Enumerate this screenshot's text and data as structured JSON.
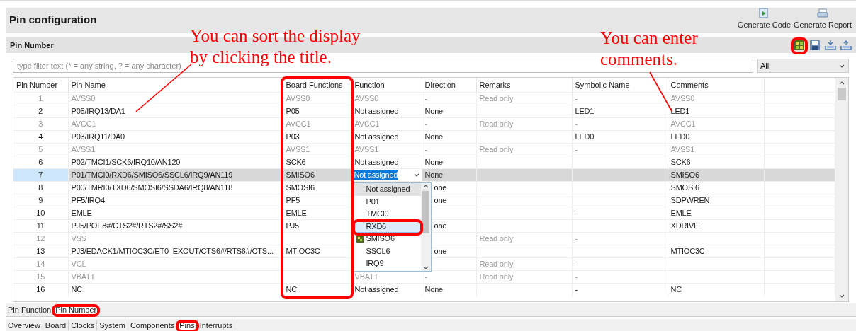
{
  "header": {
    "title": "Pin configuration",
    "actions": [
      {
        "label": "Generate Code",
        "kind": "code"
      },
      {
        "label": "Generate Report",
        "kind": "report"
      }
    ]
  },
  "section": {
    "title": "Pin Number",
    "tools": [
      {
        "kind": "grid",
        "highlighted": true
      },
      {
        "kind": "save",
        "highlighted": false
      },
      {
        "kind": "import",
        "highlighted": false
      },
      {
        "kind": "export",
        "highlighted": false
      }
    ]
  },
  "filter": {
    "placeholder": "type filter text (* = any string, ? = any character)",
    "scope": "All"
  },
  "table": {
    "columns": [
      {
        "label": "Pin Number",
        "highlighted": false
      },
      {
        "label": "Pin Name",
        "highlighted": false
      },
      {
        "label": "Board Functions",
        "highlighted": true
      },
      {
        "label": "Function",
        "highlighted": false
      },
      {
        "label": "Direction",
        "highlighted": false
      },
      {
        "label": "Remarks",
        "highlighted": false
      },
      {
        "label": "Symbolic Name",
        "highlighted": false
      },
      {
        "label": "Comments",
        "highlighted": false
      }
    ],
    "rows": [
      {
        "read_only": true,
        "selected": false,
        "cells": [
          "1",
          "AVSS0",
          "AVSS0",
          "AVSS0",
          "-",
          "Read only",
          "-",
          "AVSS0"
        ]
      },
      {
        "read_only": false,
        "selected": false,
        "cells": [
          "2",
          "P05/IRQ13/DA1",
          "P05",
          "Not assigned",
          "None",
          null,
          "LED1",
          "LED1"
        ]
      },
      {
        "read_only": true,
        "selected": false,
        "cells": [
          "3",
          "AVCC1",
          "AVCC1",
          "AVCC1",
          "-",
          "Read only",
          "-",
          "AVCC1"
        ]
      },
      {
        "read_only": false,
        "selected": false,
        "cells": [
          "4",
          "P03/IRQ11/DA0",
          "P03",
          "Not assigned",
          "None",
          null,
          "LED0",
          "LED0"
        ]
      },
      {
        "read_only": true,
        "selected": false,
        "cells": [
          "5",
          "AVSS1",
          "AVSS1",
          "AVSS1",
          "-",
          "Read only",
          "-",
          "AVSS1"
        ]
      },
      {
        "read_only": false,
        "selected": false,
        "cells": [
          "6",
          "P02/TMCI1/SCK6/IRQ10/AN120",
          "SCK6",
          "Not assigned",
          "None",
          null,
          null,
          "SCK6"
        ]
      },
      {
        "read_only": false,
        "selected": true,
        "cells": [
          "7",
          "P01/TMCI0/RXD6/SMISO6/SSCL6/IRQ9/AN119",
          "SMISO6",
          null,
          "None",
          null,
          null,
          "SMISO6"
        ],
        "editor": {
          "value": "Not assigned",
          "options": [
            {
              "label": "Not assigned",
              "selected": true,
              "hovered": false,
              "highlighted": false,
              "assigned_icon": false
            },
            {
              "label": "P01",
              "selected": false,
              "hovered": false,
              "highlighted": false,
              "assigned_icon": false
            },
            {
              "label": "TMCI0",
              "selected": false,
              "hovered": false,
              "highlighted": false,
              "assigned_icon": false
            },
            {
              "label": "RXD6",
              "selected": false,
              "hovered": true,
              "highlighted": true,
              "assigned_icon": false
            },
            {
              "label": "SMISO6",
              "selected": false,
              "hovered": false,
              "highlighted": false,
              "assigned_icon": true
            },
            {
              "label": "SSCL6",
              "selected": false,
              "hovered": false,
              "highlighted": false,
              "assigned_icon": false
            },
            {
              "label": "IRQ9",
              "selected": false,
              "hovered": false,
              "highlighted": false,
              "assigned_icon": false
            }
          ]
        }
      },
      {
        "read_only": false,
        "selected": false,
        "cells": [
          "8",
          "P00/TMRI0/TXD6/SMOSI6/SSDA6/IRQ8/AN118",
          "SMOSI6",
          null,
          "one",
          null,
          null,
          "SMOSI6"
        ]
      },
      {
        "read_only": false,
        "selected": false,
        "cells": [
          "9",
          "PF5/IRQ4",
          "PF5",
          null,
          "one",
          null,
          null,
          "SDPWREN"
        ]
      },
      {
        "read_only": false,
        "selected": false,
        "cells": [
          "10",
          "EMLE",
          "EMLE",
          null,
          null,
          null,
          "-",
          "EMLE"
        ]
      },
      {
        "read_only": false,
        "selected": false,
        "cells": [
          "11",
          "PJ5/POE8#/CTS2#/RTS2#/SS2#",
          "PJ5",
          null,
          "one",
          null,
          null,
          "XDRIVE"
        ]
      },
      {
        "read_only": true,
        "selected": false,
        "cells": [
          "12",
          "VSS",
          null,
          null,
          null,
          "Read only",
          "-",
          null
        ]
      },
      {
        "read_only": false,
        "selected": false,
        "cells": [
          "13",
          "PJ3/EDACK1/MTIOC3C/ET0_EXOUT/CTS6#/RTS6#/CTS...",
          "MTIOC3C",
          null,
          "one",
          null,
          null,
          "MTIOC3C"
        ]
      },
      {
        "read_only": true,
        "selected": false,
        "cells": [
          "14",
          "VCL",
          null,
          null,
          null,
          "Read only",
          "-",
          null
        ]
      },
      {
        "read_only": true,
        "selected": false,
        "cells": [
          "15",
          "VBATT",
          null,
          "VBATT",
          "-",
          "Read only",
          "-",
          null
        ]
      },
      {
        "read_only": false,
        "selected": false,
        "cells": [
          "16",
          "NC",
          "NC",
          "Not assigned",
          "None",
          null,
          "-",
          "NC"
        ]
      }
    ]
  },
  "view_tabs": [
    {
      "label": "Pin Function",
      "selected": false,
      "highlighted": false
    },
    {
      "label": "Pin Number",
      "selected": true,
      "highlighted": true
    }
  ],
  "editor_tabs": [
    {
      "label": "Overview",
      "selected": false,
      "highlighted": false
    },
    {
      "label": "Board",
      "selected": false,
      "highlighted": false
    },
    {
      "label": "Clocks",
      "selected": false,
      "highlighted": false
    },
    {
      "label": "System",
      "selected": false,
      "highlighted": false
    },
    {
      "label": "Components",
      "selected": false,
      "highlighted": false
    },
    {
      "label": "Pins",
      "selected": true,
      "highlighted": true
    },
    {
      "label": "Interrupts",
      "selected": false,
      "highlighted": false
    }
  ],
  "callouts": [
    {
      "text": "You can sort the display\nby clicking the title."
    },
    {
      "text": "You can enter\ncomments."
    }
  ]
}
